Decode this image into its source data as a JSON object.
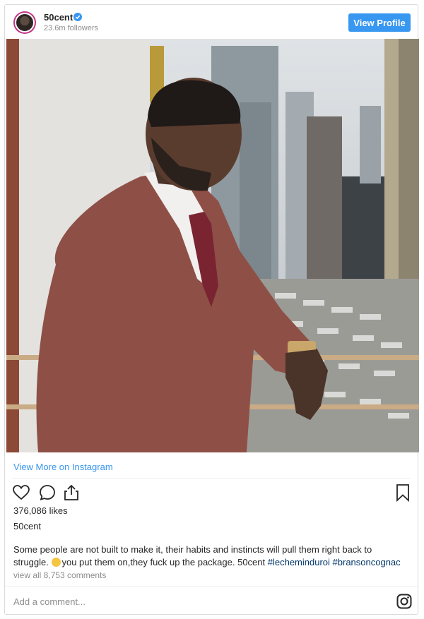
{
  "header": {
    "username": "50cent",
    "followers": "23.6m followers",
    "view_profile_label": "View Profile"
  },
  "post": {
    "view_more_label": "View More on Instagram",
    "likes": "376,086 likes",
    "owner": "50cent",
    "caption": {
      "text_1": "Some people are not built to make it, their habits and instincts will pull them right back to struggle. ",
      "text_2": "you put them on,they fuck up the package. 50cent ",
      "hashtag_1": "#lecheminduroi",
      "hashtag_2": "#bransoncognac"
    },
    "view_all_comments": "view all 8,753 comments"
  },
  "comment_box": {
    "placeholder": "Add a comment..."
  },
  "colors": {
    "accent": "#3897f0",
    "hashtag": "#003569",
    "muted": "#8e8e8e"
  },
  "icons": [
    "heart-icon",
    "comment-icon",
    "share-icon",
    "bookmark-icon",
    "instagram-icon",
    "verified-badge-icon"
  ]
}
